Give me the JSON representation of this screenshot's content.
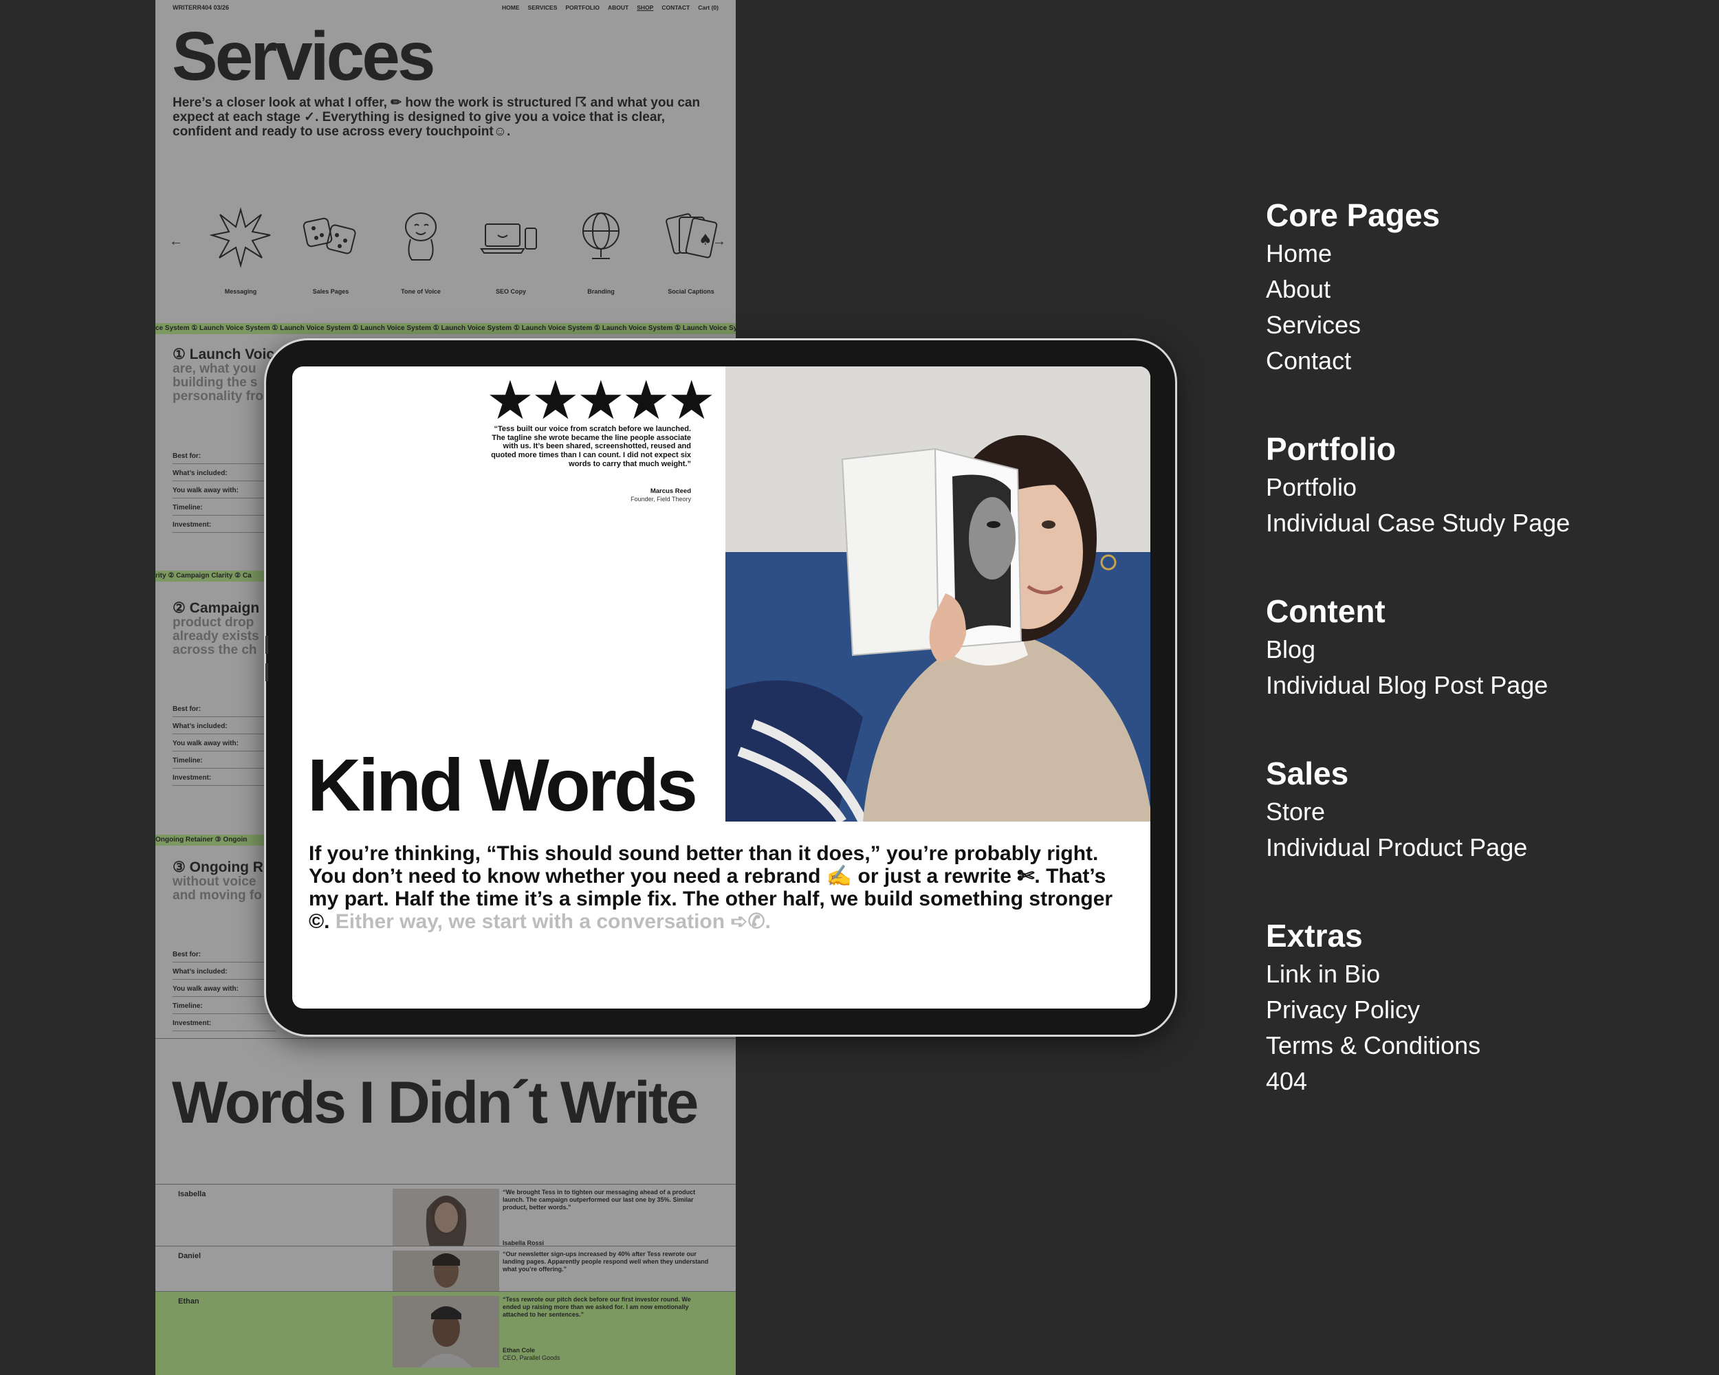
{
  "site": {
    "brand": "WRITERR404 03/26",
    "nav": [
      "HOME",
      "SERVICES",
      "PORTFOLIO",
      "ABOUT",
      "SHOP",
      "CONTACT",
      "Cart (0)"
    ],
    "title": "Services",
    "intro": "Here’s a closer look at what I offer, ✏ how the work is structured ☈ and what you can expect at each stage ✓. Everything is designed to give you a voice that is clear, confident and ready to use across every touchpoint☺.",
    "carousel": {
      "prev": "←",
      "next": "→",
      "items": [
        {
          "label": "Messaging",
          "icon": "star-burst-icon"
        },
        {
          "label": "Sales Pages",
          "icon": "dice-icon"
        },
        {
          "label": "Tone of Voice",
          "icon": "character-icon"
        },
        {
          "label": "SEO Copy",
          "icon": "laptop-phone-icon"
        },
        {
          "label": "Branding",
          "icon": "globe-icon"
        },
        {
          "label": "Social Captions",
          "icon": "playing-cards-icon"
        }
      ]
    },
    "tickers": {
      "one": "ce System ① Launch Voice System ① Launch Voice System ① Launch Voice System ① Launch Voice System ① Launch Voice System ① Launch Voice System ① Launch Voice System",
      "two": "rity ② Campaign Clarity ② Ca",
      "three": "Ongoing Retainer ③ Ongoin"
    },
    "packages": [
      {
        "title": "① Launch Voic",
        "desc": [
          "are, what you",
          "building the s",
          "personality fro"
        ]
      },
      {
        "title": "② Campaign C",
        "desc": [
          "product drop",
          "already exists",
          "across the ch"
        ]
      },
      {
        "title": "③ Ongoing Re",
        "desc": [
          "without voice",
          "and moving fo"
        ]
      }
    ],
    "package_rows": [
      "Best for:",
      "What’s included:",
      "You walk away with:",
      "Timeline:",
      "Investment:"
    ],
    "words_title": "Words I Didn´t Write",
    "testimonials": [
      {
        "name": "Isabella",
        "quote": "“We brought Tess in to tighten our messaging ahead of a product launch. The campaign outperformed our last one by 35%. Similar product, better words.”",
        "author": "Isabella Rossi",
        "role": ""
      },
      {
        "name": "Daniel",
        "quote": "“Our newsletter sign-ups increased by 40% after Tess rewrote our landing pages. Apparently people respond well when they understand what you’re offering.”",
        "author": "",
        "role": ""
      },
      {
        "name": "Ethan",
        "quote": "“Tess rewrote our pitch deck before our first investor round. We ended up raising more than we asked for. I am now emotionally attached to her sentences.”",
        "author": "Ethan Cole",
        "role": "CEO, Parallel Goods"
      }
    ]
  },
  "ipad": {
    "stars": "★★★★★",
    "rating_stars": 5,
    "review_quote": "“Tess built our voice from scratch before we launched. The tagline she wrote became the line people associate with us. It’s been shared, screenshotted, reused and quoted more times than I can count. I did not expect six words to carry that much weight.”",
    "review_name": "Marcus Reed",
    "review_role": "Founder, Field Theory",
    "title": "Kind Words",
    "body": "If you’re thinking, “This should sound better than it does,” you’re probably right. You don’t need to know whether you need a rebrand ✍ or just a rewrite ✄. That’s my part. Half the time it’s a simple fix. The other half, we build something stronger ©.",
    "body_muted": "Either way, we start with a conversation ➪✆."
  },
  "sitemap": [
    {
      "heading": "Core Pages",
      "links": [
        "Home",
        "About",
        "Services",
        "Contact"
      ]
    },
    {
      "heading": "Portfolio",
      "links": [
        "Portfolio",
        "Individual Case Study Page"
      ]
    },
    {
      "heading": "Content",
      "links": [
        "Blog",
        "Individual Blog Post Page"
      ]
    },
    {
      "heading": "Sales",
      "links": [
        "Store",
        "Individual Product Page"
      ]
    },
    {
      "heading": "Extras",
      "links": [
        "Link in Bio",
        "Privacy Policy",
        "Terms & Conditions",
        "404"
      ]
    }
  ],
  "colors": {
    "background": "#2a2a2a",
    "accent_green": "#b9e98b",
    "ink": "#111111",
    "muted_text": "#bdbdbd"
  }
}
